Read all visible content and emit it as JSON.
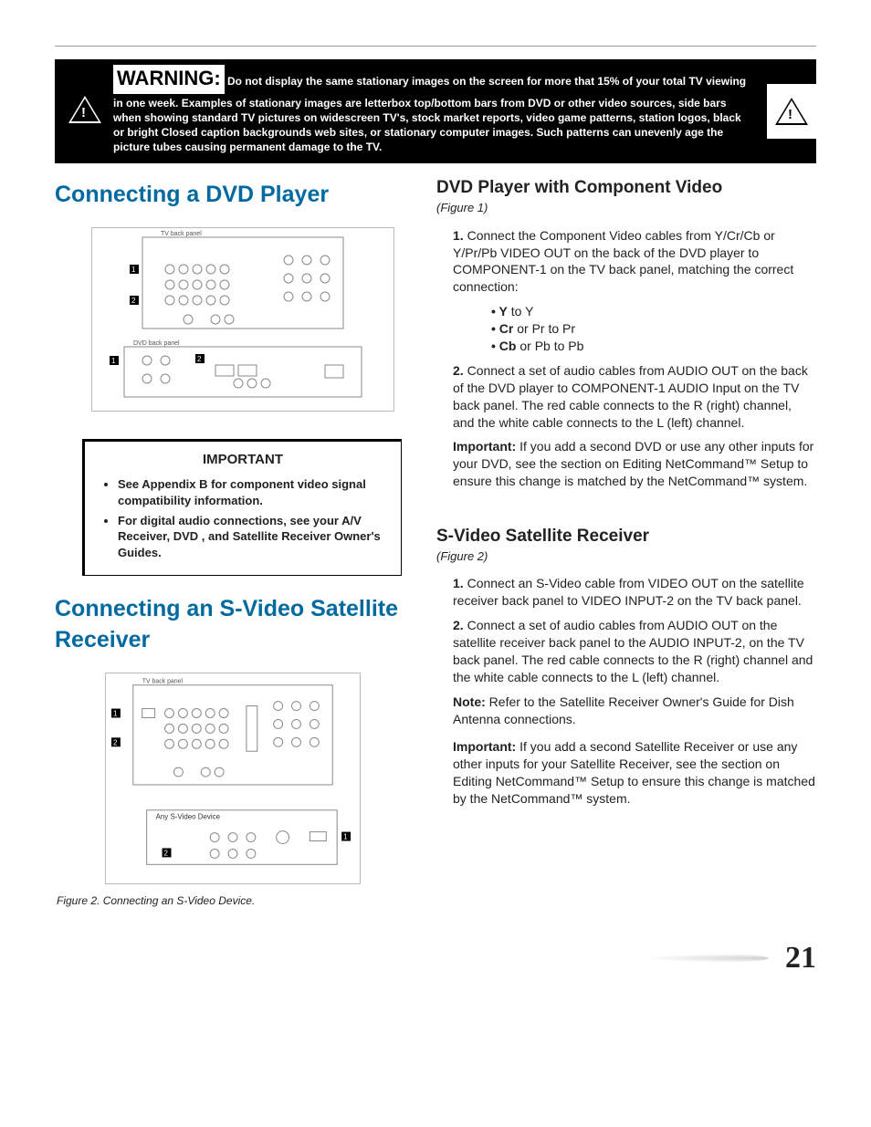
{
  "warning": {
    "header": "WARNING:",
    "text": "Do not display the same stationary images on the screen for more that 15% of    your total TV viewing in one week.  Examples of stationary images are letterbox top/bottom bars from DVD or other video sources, side bars when showing standard TV pictures on widescreen TV's, stock market reports, video game patterns, station logos, black or bright Closed caption backgrounds web sites, or stationary computer images. Such patterns can unevenly age the picture tubes causing permanent damage to the TV."
  },
  "left": {
    "heading1": "Connecting a DVD Player",
    "fig1": {
      "top_label": "TV back panel",
      "bottom_label": "DVD back panel"
    },
    "important": {
      "title": "IMPORTANT",
      "items": [
        "See Appendix B  for component video signal compatibility information.",
        "For digital audio connections, see your A/V Receiver, DVD , and Satellite Receiver Owner's Guides."
      ]
    },
    "heading2": "Connecting an S-Video Satellite Receiver",
    "fig2": {
      "top_label": "TV back panel",
      "bottom_label": "Any S-Video Device"
    },
    "figcap2": "Figure 2.  Connecting an S-Video Device."
  },
  "right": {
    "dvd": {
      "heading": "DVD Player with Component Video",
      "figref": "(Figure 1)",
      "step1_num": "1.",
      "step1": "Connect the Component Video cables from Y/Cr/Cb or Y/Pr/Pb VIDEO OUT on the back of the DVD player to COMPONENT-1 on the TV back panel, matching the correct connection:",
      "bullets": {
        "b1_pre": "Y",
        "b1_post": " to Y",
        "b2_pre": "Cr",
        "b2_post": " or Pr to Pr",
        "b3_pre": "Cb",
        "b3_post": " or Pb to Pb"
      },
      "step2_num": "2.",
      "step2": "Connect a set of audio cables from AUDIO OUT on the back of the DVD player to COMPONENT-1 AUDIO Input on the TV back panel.  The red cable connects to the R (right) channel, and the white cable connects to the L (left) channel.",
      "imp_label": "Important:",
      "imp_text": "  If you add a second DVD or use any other inputs for your DVD, see the section on Editing NetCommand™ Setup to ensure this change is matched by the NetCommand™ system."
    },
    "svideo": {
      "heading": "S-Video Satellite Receiver",
      "figref": "(Figure 2)",
      "step1_num": "1.",
      "step1": "Connect an S-Video cable from VIDEO OUT on the satellite receiver back panel to VIDEO INPUT-2 on the TV back panel.",
      "step2_num": "2.",
      "step2": " Connect a set of audio cables from AUDIO OUT on the satellite receiver back panel to the AUDIO INPUT-2, on the TV back panel.  The red cable connects to the R (right) channel and the white cable connects to the L (left) channel.",
      "note_label": "Note:",
      "note_text": "  Refer to the Satellite Receiver Owner's Guide  for Dish Antenna connections.",
      "imp_label": "Important:",
      "imp_text": "  If you add a second Satellite Receiver or use any other inputs for your Satellite Receiver, see the section on Editing NetCommand™ Setup to ensure this change is matched by the NetCommand™ system."
    }
  },
  "page": "21"
}
